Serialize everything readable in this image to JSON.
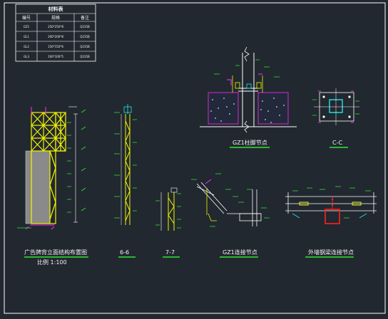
{
  "colors": {
    "background": "#212830",
    "frame": "#ffffff",
    "steel": "#f4f400",
    "dimension": "#2ee82e",
    "section": "#ff2bff",
    "concrete": "#9ef0ff",
    "highlight": "#ff2020",
    "cyan": "#25e6e6",
    "label": "#f2f2f2"
  },
  "table": {
    "title": "材料表",
    "headers": [
      "编号",
      "规格",
      "备注"
    ],
    "rows": [
      {
        "code": "GZ1",
        "spec": "250*250*8",
        "note": "Q235B"
      },
      {
        "code": "GL1",
        "spec": "200*200*8",
        "note": "Q235B"
      },
      {
        "code": "GL2",
        "spec": "150*150*6",
        "note": "Q235B"
      },
      {
        "code": "GL3",
        "spec": "100*100*5",
        "note": "Q235B"
      }
    ]
  },
  "views": {
    "elevation": {
      "title": "广告牌背立面结构布置图",
      "subtitle": "比例 1:100"
    },
    "section_6": {
      "title": "6-6"
    },
    "section_7": {
      "title": "7-7"
    },
    "column_base": {
      "title": "GZ1柱脚节点"
    },
    "section_c": {
      "title": "C-C"
    },
    "gz1_connection": {
      "title": "GZ1连接节点"
    },
    "wall_connection": {
      "title": "外墙钢梁连接节点"
    }
  }
}
